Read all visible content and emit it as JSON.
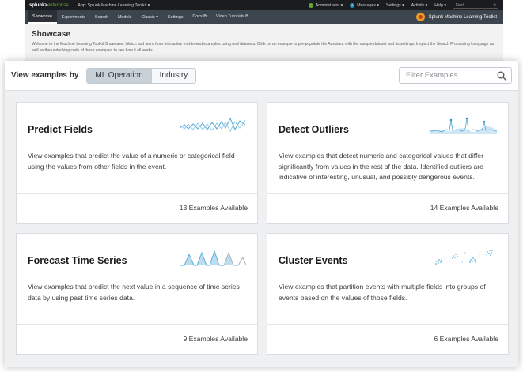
{
  "topbar": {
    "logo_main": "splunk>",
    "logo_sub": "enterprise",
    "app_label": "App: Splunk Machine Learning Toolkit ▾",
    "user": "Administrator ▾",
    "messages_count": "2",
    "messages": "Messages ▾",
    "settings": "Settings ▾",
    "activity": "Activity ▾",
    "help": "Help ▾",
    "find_placeholder": "Find"
  },
  "navbar": {
    "items": [
      "Showcase",
      "Experiments",
      "Search",
      "Models",
      "Classic ▾",
      "Settings",
      "Docs ⧉",
      "Video Tutorials ⧉"
    ],
    "brand": "Splunk Machine Learning Toolkit"
  },
  "header": {
    "title": "Showcase",
    "description": "Welcome to the Machine Learning Toolkit Showcase. Watch and learn from interactive end-to-end examples using real datasets. Click on an example to pre-populate the Assistant with the sample dataset and its settings. Inspect the Search Processing Language as well as the underlying code of these examples to see how it all works."
  },
  "toolbar": {
    "label": "View examples by",
    "options": [
      "ML Operation",
      "Industry"
    ],
    "selected": "ML Operation",
    "filter_placeholder": "Filter Examples"
  },
  "cards": [
    {
      "title": "Predict Fields",
      "description": "View examples that predict the value of a numeric or categorical field using the values from other fields in the event.",
      "count": "13 Examples Available",
      "icon": "predict-fields-icon"
    },
    {
      "title": "Detect Outliers",
      "description": "View examples that detect numeric and categorical values that differ significantly from values in the rest of the data. Identified outliers are indicative of interesting, unusual, and possibly dangerous events.",
      "count": "14 Examples Available",
      "icon": "detect-outliers-icon"
    },
    {
      "title": "Forecast Time Series",
      "description": "View examples that predict the next value in a sequence of time series data by using past time series data.",
      "count": "9 Examples Available",
      "icon": "forecast-time-series-icon"
    },
    {
      "title": "Cluster Events",
      "description": "View examples that partition events with multiple fields into groups of events based on the values of those fields.",
      "count": "6 Examples Available",
      "icon": "cluster-events-icon"
    }
  ],
  "colors": {
    "accent_blue": "#5aaed9",
    "nav_dark": "#3c444d",
    "topbar_dark": "#1a1c20",
    "splunk_green": "#65a637"
  }
}
